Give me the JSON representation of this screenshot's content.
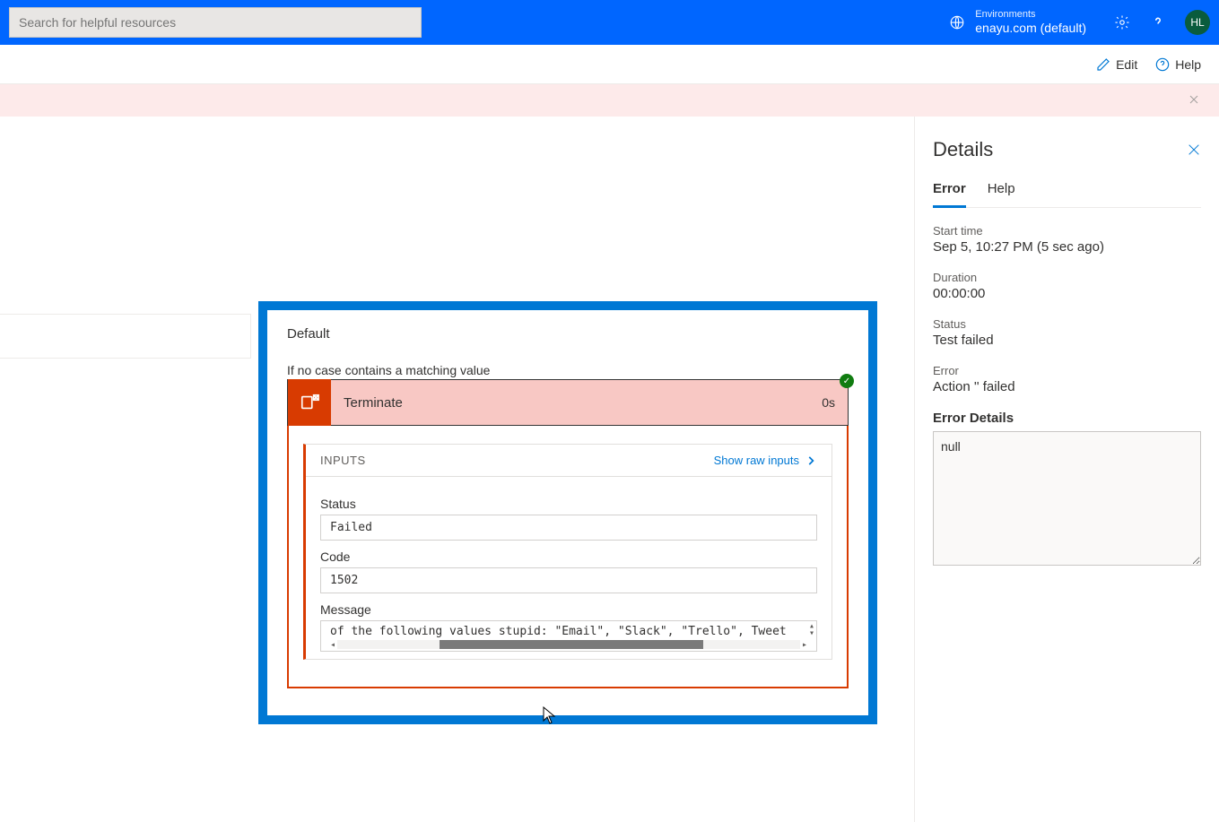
{
  "topbar": {
    "search_placeholder": "Search for helpful resources",
    "env_label": "Environments",
    "env_value": "enayu.com (default)",
    "avatar_initials": "HL"
  },
  "cmdbar": {
    "edit_label": "Edit",
    "help_label": "Help"
  },
  "flow": {
    "default_label": "Default",
    "subtext": "If no case contains a matching value",
    "terminate": {
      "title": "Terminate",
      "time": "0s",
      "inputs_label": "INPUTS",
      "raw_link": "Show raw inputs",
      "fields": {
        "status_label": "Status",
        "status_value": "Failed",
        "code_label": "Code",
        "code_value": "1502",
        "message_label": "Message",
        "message_value": "of the following values stupid: \"Email\", \"Slack\", \"Trello\", Tweet"
      }
    }
  },
  "details": {
    "title": "Details",
    "tabs": {
      "error": "Error",
      "help": "Help"
    },
    "start_time_label": "Start time",
    "start_time_value": "Sep 5, 10:27 PM (5 sec ago)",
    "duration_label": "Duration",
    "duration_value": "00:00:00",
    "status_label": "Status",
    "status_value": "Test failed",
    "error_label": "Error",
    "error_value": "Action '' failed",
    "error_details_label": "Error Details",
    "error_details_value": "null"
  }
}
